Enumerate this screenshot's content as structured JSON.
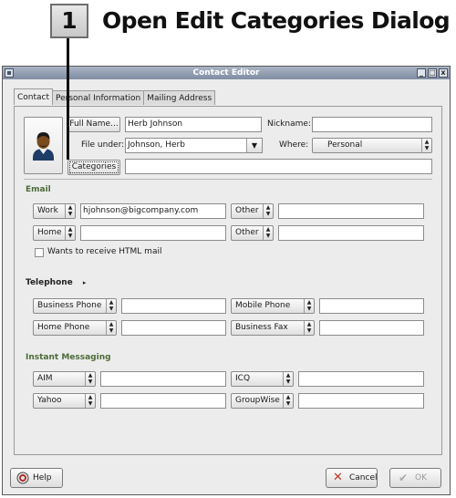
{
  "callout": {
    "number": "1",
    "title": "Open Edit Categories Dialog"
  },
  "window": {
    "title": "Contact Editor",
    "controls": [
      "_",
      "□",
      "x"
    ]
  },
  "tabs": [
    {
      "label": "Contact",
      "active": true
    },
    {
      "label": "Personal Information",
      "active": false
    },
    {
      "label": "Mailing Address",
      "active": false
    }
  ],
  "identity": {
    "full_name_button": "Full Name...",
    "full_name_value": "Herb Johnson",
    "nickname_label": "Nickname:",
    "nickname_value": "",
    "file_under_label": "File under:",
    "file_under_value": "Johnson, Herb",
    "where_label": "Where:",
    "where_value": "Personal",
    "categories_button": "Categories",
    "categories_value": ""
  },
  "email": {
    "heading": "Email",
    "rows": [
      {
        "type": "Work",
        "value": "hjohnson@bigcompany.com",
        "type2": "Other",
        "value2": ""
      },
      {
        "type": "Home",
        "value": "",
        "type2": "Other",
        "value2": ""
      }
    ],
    "html_mail_label": "Wants to receive HTML mail",
    "html_mail_checked": false
  },
  "telephone": {
    "heading": "Telephone",
    "rows": [
      {
        "type": "Business Phone",
        "value": "",
        "type2": "Mobile Phone",
        "value2": ""
      },
      {
        "type": "Home Phone",
        "value": "",
        "type2": "Business Fax",
        "value2": ""
      }
    ]
  },
  "instant_messaging": {
    "heading": "Instant Messaging",
    "rows": [
      {
        "type": "AIM",
        "value": "",
        "type2": "ICQ",
        "value2": ""
      },
      {
        "type": "Yahoo",
        "value": "",
        "type2": "GroupWise",
        "value2": ""
      }
    ]
  },
  "footer": {
    "help": "Help",
    "cancel": "Cancel",
    "ok": "OK",
    "ok_enabled": false
  },
  "colors": {
    "section_heading": "#4d6b3a",
    "titlebar": "#8794a8",
    "cancel_icon": "#c0392b"
  }
}
